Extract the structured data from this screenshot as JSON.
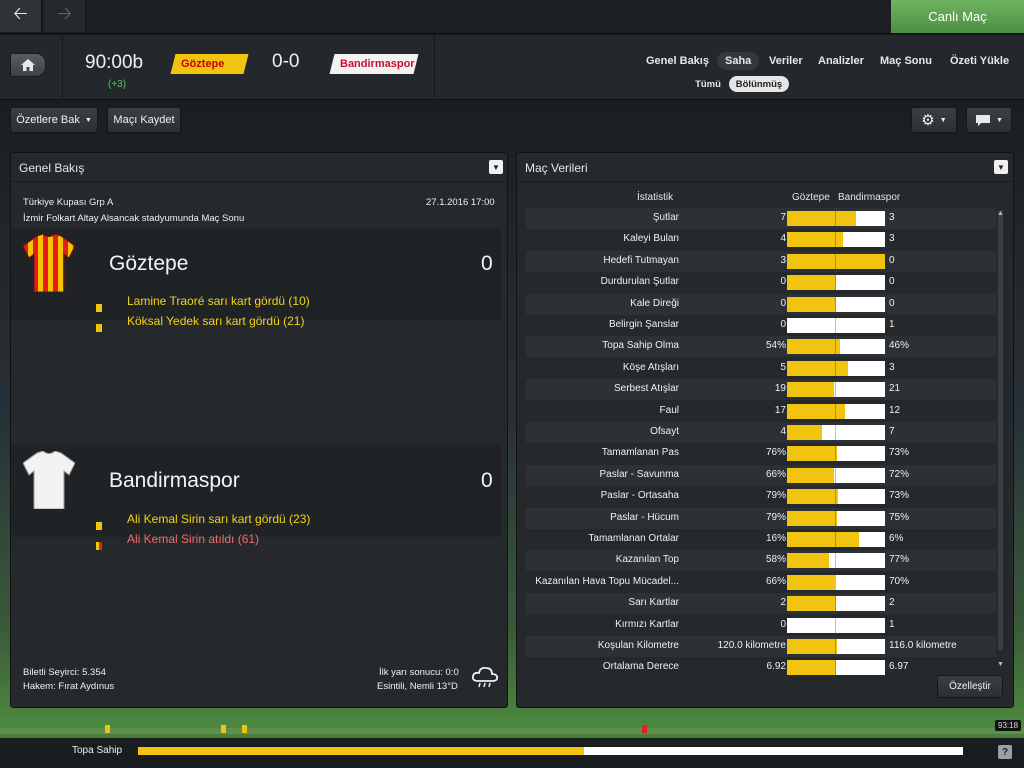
{
  "topbar": {
    "back_icon": "arrow-left-icon",
    "forward_icon": "arrow-right-icon",
    "live_label": "Canlı Maç"
  },
  "header": {
    "time": "90:00b",
    "added_time": "(+3)",
    "home_team": "Göztepe",
    "away_team": "Bandirmaspor",
    "score": "0-0",
    "home_color": "#f1c40f",
    "away_color": "#f2f2f2",
    "menu": [
      "Genel Bakış",
      "Saha",
      "Veriler",
      "Analizler",
      "Maç Sonu",
      "Özeti Yükle"
    ],
    "active_menu": "Saha",
    "sub_tabs": [
      "Tümü",
      "Bölünmüş"
    ],
    "active_sub_tab": "Bölünmüş"
  },
  "toolbar": {
    "highlights_label": "Özetlere Bak",
    "save_label": "Maçı Kaydet"
  },
  "overview": {
    "title": "Genel Bakış",
    "competition": "Türkiye Kupası Grp A",
    "venue": "İzmir Folkart Altay Alsancak stadyumunda Maç Sonu",
    "datetime": "27.1.2016 17:00",
    "home": {
      "name": "Göztepe",
      "score": "0",
      "events": [
        {
          "type": "yellow",
          "text": "Lamine Traoré sarı kart gördü (10)"
        },
        {
          "type": "yellow",
          "text": "Köksal Yedek sarı kart gördü (21)"
        }
      ]
    },
    "away": {
      "name": "Bandirmaspor",
      "score": "0",
      "events": [
        {
          "type": "yellow",
          "text": "Ali Kemal Sirin sarı kart gördü (23)"
        },
        {
          "type": "red",
          "text": "Ali Kemal Sirin atıldı (61)"
        }
      ]
    },
    "attendance": "Biletli Seyirci: 5.354",
    "referee": "Hakem: Fırat Aydınus",
    "halftime": "İlk yarı sonucu: 0:0",
    "weather": "Esintili, Nemli 13°D",
    "weather_icon": "rain-cloud-icon"
  },
  "stats": {
    "title": "Maç Verileri",
    "col_stat": "İstatistik",
    "col_home": "Göztepe",
    "col_away": "Bandirmaspor",
    "customize_label": "Özelleştir",
    "rows": [
      {
        "label": "Şutlar",
        "home": "7",
        "away": "3",
        "share": 0.7
      },
      {
        "label": "Kaleyi Bulan",
        "home": "4",
        "away": "3",
        "share": 0.57
      },
      {
        "label": "Hedefi Tutmayan",
        "home": "3",
        "away": "0",
        "share": 1.0
      },
      {
        "label": "Durdurulan Şutlar",
        "home": "0",
        "away": "0",
        "share": 0.5
      },
      {
        "label": "Kale Direği",
        "home": "0",
        "away": "0",
        "share": 0.5
      },
      {
        "label": "Belirgin Şanslar",
        "home": "0",
        "away": "1",
        "share": 0.0
      },
      {
        "label": "Topa Sahip Olma",
        "home": "54%",
        "away": "46%",
        "share": 0.54
      },
      {
        "label": "Köşe Atışları",
        "home": "5",
        "away": "3",
        "share": 0.62
      },
      {
        "label": "Serbest Atışlar",
        "home": "19",
        "away": "21",
        "share": 0.48
      },
      {
        "label": "Faul",
        "home": "17",
        "away": "12",
        "share": 0.59
      },
      {
        "label": "Ofsayt",
        "home": "4",
        "away": "7",
        "share": 0.36
      },
      {
        "label": "Tamamlanan Pas",
        "home": "76%",
        "away": "73%",
        "share": 0.51
      },
      {
        "label": "Paslar - Savunma",
        "home": "66%",
        "away": "72%",
        "share": 0.48
      },
      {
        "label": "Paslar - Ortasaha",
        "home": "79%",
        "away": "73%",
        "share": 0.52
      },
      {
        "label": "Paslar - Hücum",
        "home": "79%",
        "away": "75%",
        "share": 0.51
      },
      {
        "label": "Tamamlanan Ortalar",
        "home": "16%",
        "away": "6%",
        "share": 0.73
      },
      {
        "label": "Kazanılan Top",
        "home": "58%",
        "away": "77%",
        "share": 0.43
      },
      {
        "label": "Kazanılan Hava Topu Mücadel...",
        "home": "66%",
        "away": "70%",
        "share": 0.49
      },
      {
        "label": "Sarı Kartlar",
        "home": "2",
        "away": "2",
        "share": 0.5
      },
      {
        "label": "Kırmızı Kartlar",
        "home": "0",
        "away": "1",
        "share": 0.0
      },
      {
        "label": "Koşulan Kilometre",
        "home": "120.0 kilometre",
        "away": "116.0 kilometre",
        "share": 0.51
      },
      {
        "label": "Ortalama Derece",
        "home": "6.92",
        "away": "6.97",
        "share": 0.5
      }
    ]
  },
  "timeline": {
    "time": "93:18",
    "possession_label": "Topa Sahip",
    "possession_share": 0.54,
    "markers": [
      {
        "minute": 10,
        "color": "#f1c40f"
      },
      {
        "minute": 21,
        "color": "#f1c40f"
      },
      {
        "minute": 23,
        "color": "#f1c40f"
      },
      {
        "minute": 61,
        "color": "#e0231f"
      }
    ],
    "help_label": "?"
  }
}
